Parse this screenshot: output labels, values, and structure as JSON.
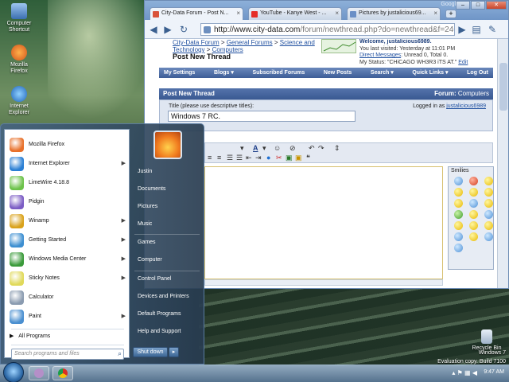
{
  "desktop": {
    "icons": [
      {
        "label": "Computer\nShortcut"
      },
      {
        "label": "Mozilla\nFirefox"
      },
      {
        "label": "Internet\nExplorer"
      },
      {
        "label": "Recycle Bin"
      }
    ],
    "watermark": {
      "line1": "Windows 7",
      "line2": "Evaluation copy. Build 7100"
    }
  },
  "browser": {
    "tabs": [
      {
        "label": "City-Data Forum - Post N..."
      },
      {
        "label": "YouTube - Kanye West - ..."
      },
      {
        "label": "Pictures by justalicious69..."
      }
    ],
    "google_label": "Google",
    "url_host": "http://www.city-data.com",
    "url_path": "/forum/newthread.php?do=newthread&f=246"
  },
  "page": {
    "breadcrumb": {
      "l1": "City-Data Forum",
      "sep1": " > ",
      "l2": "General Forums",
      "sep2": " > ",
      "l3": "Science and",
      "l4": "Technology",
      "sep3": " > ",
      "l5": "Computers",
      "title": "Post New Thread"
    },
    "welcome": {
      "line1": "Welcome, justalicious6989.",
      "line2": "You last visited: Yesterday at 11:01 PM",
      "dm_link": "Direct Messages",
      "dm_text": ": Unread 0, Total 0.",
      "status": "My Status: \"CHiCAGO WH3R3 iTS AT.\"",
      "edit": "Edit"
    },
    "menu": [
      "My Settings",
      "Blogs ▾",
      "Subscribed Forums",
      "New Posts",
      "Search ▾",
      "Quick Links ▾",
      "Log Out"
    ],
    "panel": {
      "heading": "Post New Thread",
      "forum_label": "Forum:",
      "forum_name": "Computers",
      "title_label": "Title (please use descriptive titles):",
      "title_value": "Windows 7 RC.",
      "logged_prefix": "Logged in as ",
      "logged_user": "justalicious6989"
    },
    "smilies_label": "Smilies"
  },
  "start_menu": {
    "programs": [
      {
        "label": "Mozilla Firefox",
        "color": "#e8702a",
        "submenu": false
      },
      {
        "label": "Internet Explorer",
        "color": "#2a7fd4",
        "submenu": true
      },
      {
        "label": "LimeWire 4.18.8",
        "color": "#6cc24a",
        "submenu": false
      },
      {
        "label": "Pidgin",
        "color": "#7b5cc4",
        "submenu": false
      },
      {
        "label": "Winamp",
        "color": "#d9a21b",
        "submenu": true
      },
      {
        "label": "Getting Started",
        "color": "#3d8fd1",
        "submenu": true
      },
      {
        "label": "Windows Media Center",
        "color": "#3a9a3a",
        "submenu": true
      },
      {
        "label": "Sticky Notes",
        "color": "#e0d95a",
        "submenu": true
      },
      {
        "label": "Calculator",
        "color": "#8a9bb0",
        "submenu": false
      },
      {
        "label": "Paint",
        "color": "#4a8fd0",
        "submenu": true
      }
    ],
    "all_programs": "All Programs",
    "search_placeholder": "Search programs and files",
    "right_items": [
      "Justin",
      "Documents",
      "Pictures",
      "Music",
      "Games",
      "Computer",
      "Control Panel",
      "Devices and Printers",
      "Default Programs",
      "Help and Support"
    ],
    "shutdown_label": "Shut down"
  },
  "taskbar": {
    "clock": "9:47 AM"
  }
}
